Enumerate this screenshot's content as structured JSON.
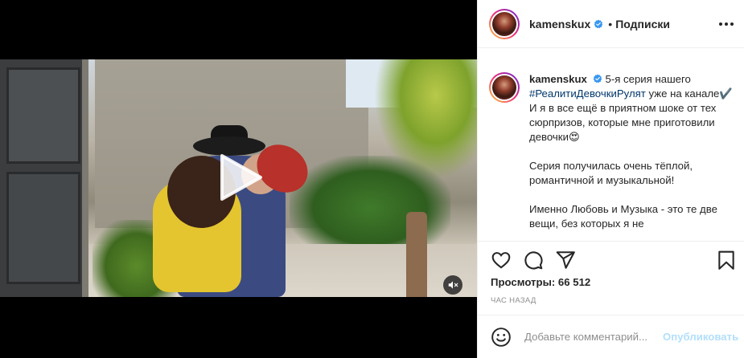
{
  "post": {
    "username": "kamenskux",
    "follow_label": "Подписки",
    "separator": "•"
  },
  "caption": {
    "username": "kamenskux",
    "lines": [
      {
        "text_before": "5-я серия нашего ",
        "hashtag": "#РеалитиДевочкиРулят",
        "text_after": " уже на канале✔️ И я в все ещё в приятном шоке от тех сюрпризов, которые мне приготовили девочки😍"
      },
      {
        "text": "Серия получилась очень тёплой, романтичной и музыкальной!"
      },
      {
        "text": "Именно Любовь и Музыка - это те две вещи, без которых я не"
      }
    ]
  },
  "stats": {
    "views_label": "Просмотры:",
    "views_value": "66 512",
    "time_ago": "час назад"
  },
  "comment": {
    "placeholder": "Добавьте комментарий...",
    "publish_label": "Опубликовать"
  },
  "icons": {
    "verified": "verified-badge-icon",
    "more": "more-options-icon",
    "like": "heart-icon",
    "comment": "comment-bubble-icon",
    "share": "paper-plane-icon",
    "save": "bookmark-icon",
    "emoji": "smiley-icon",
    "play": "play-icon",
    "mute": "speaker-muted-icon"
  },
  "colors": {
    "verified_blue": "#3897f0",
    "hashtag": "#00376b",
    "publish_disabled": "#b2dffc",
    "secondary_text": "#8e8e8e"
  }
}
